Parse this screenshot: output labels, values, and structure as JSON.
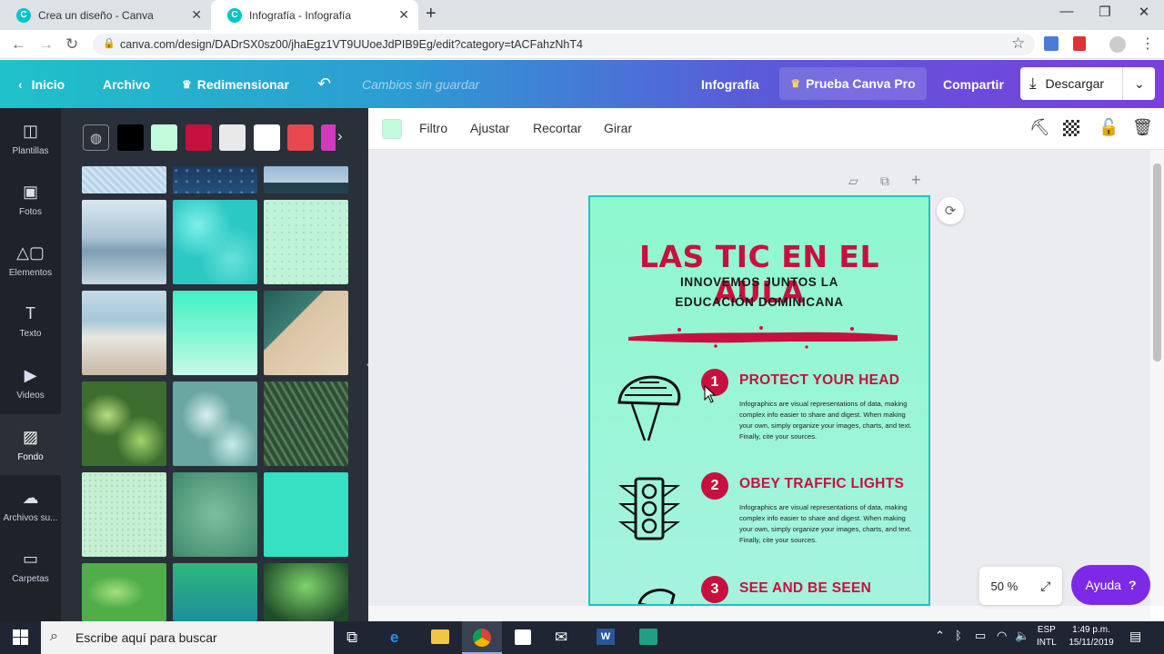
{
  "browser": {
    "tabs": [
      {
        "label": "Crea un diseño - Canva",
        "favicon": "C"
      },
      {
        "label": "Infografía - Infografía",
        "favicon": "C"
      }
    ],
    "url": "canva.com/design/DADrSX0sz00/jhaEgz1VT9UUoeJdPIB9Eg/edit?category=tACFahzNhT4"
  },
  "header": {
    "home": "Inicio",
    "file": "Archivo",
    "resize": "Redimensionar",
    "unsaved": "Cambios sin guardar",
    "doc_type": "Infografía",
    "pro": "Prueba Canva Pro",
    "share": "Compartir",
    "download": "Descargar"
  },
  "sidebar": {
    "items": [
      {
        "label": "Plantillas",
        "icon": "template-icon"
      },
      {
        "label": "Fotos",
        "icon": "photo-icon"
      },
      {
        "label": "Elementos",
        "icon": "elements-icon"
      },
      {
        "label": "Texto",
        "icon": "text-icon"
      },
      {
        "label": "Videos",
        "icon": "video-icon"
      },
      {
        "label": "Fondo",
        "icon": "background-icon"
      },
      {
        "label": "Archivos su...",
        "icon": "upload-icon"
      },
      {
        "label": "Carpetas",
        "icon": "folder-icon"
      }
    ],
    "selected": "Fondo"
  },
  "swatches": [
    "#000000",
    "#c2fadc",
    "#c8103e",
    "#e9e9e9",
    "#ffffff",
    "#e8474f",
    "#d23bbf"
  ],
  "toolbar": {
    "filter": "Filtro",
    "adjust": "Ajustar",
    "crop": "Recortar",
    "rotate": "Girar",
    "color": "#c2fadc"
  },
  "design": {
    "title": "LAS TIC EN EL AULA",
    "subtitle_1": "INNOVEMOS JUNTOS LA",
    "subtitle_2": "EDUCACIÓN DOMINICANA",
    "sections": [
      {
        "num": "1",
        "heading": "PROTECT YOUR HEAD",
        "body": "Infographics are visual representations of data, making complex info easier to share and digest. When making your own, simply organize your images, charts, and text. Finally, cite your sources."
      },
      {
        "num": "2",
        "heading": "OBEY TRAFFIC LIGHTS",
        "body": "Infographics are visual representations of data, making complex info easier to share and digest. When making your own, simply organize your images, charts, and text. Finally, cite your sources."
      },
      {
        "num": "3",
        "heading": "SEE AND BE SEEN",
        "body": ""
      }
    ]
  },
  "zoom": "50 %",
  "help": "Ayuda",
  "help_icon": "?",
  "taskbar": {
    "search_placeholder": "Escribe aquí para buscar",
    "lang_1": "ESP",
    "lang_2": "INTL",
    "time": "1:49 p.m.",
    "date": "15/11/2019"
  }
}
